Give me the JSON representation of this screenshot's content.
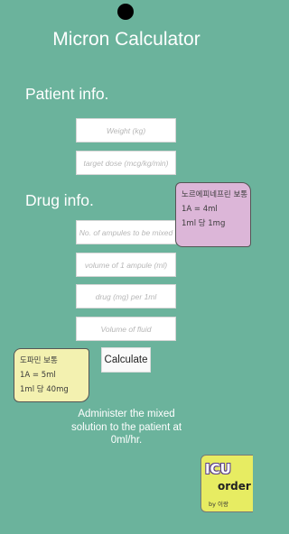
{
  "app": {
    "title": "Micron Calculator"
  },
  "patient": {
    "heading": "Patient info.",
    "weight_placeholder": "Weight (kg)",
    "dose_placeholder": "target dose (mcg/kg/min)"
  },
  "drug": {
    "heading": "Drug info.",
    "ampules_placeholder": "No. of ampules to be mixed",
    "ampule_volume_placeholder": "volume of 1 ampule (ml)",
    "drug_per_ml_placeholder": "drug (mg) per 1ml",
    "fluid_volume_placeholder": "Volume of fluid"
  },
  "actions": {
    "calculate_label": "Calculate"
  },
  "result": {
    "line1": "Administer the mixed",
    "line2": "solution to the patient at",
    "line3": "0ml/hr."
  },
  "notes": {
    "pink": {
      "line1": "노르에피네프린 보통",
      "line2": "1A = 4ml",
      "line3": "1ml 당 1mg"
    },
    "yellow": {
      "line1": "도파민 보통",
      "line2": "1A = 5ml",
      "line3": "1ml 당 40mg"
    }
  },
  "logo": {
    "big": "ICU",
    "order": "order",
    "by": "by 이랑"
  },
  "colors": {
    "background": "#6bb39c",
    "note_pink": "#dcb6d8",
    "note_yellow": "#f3f1b0",
    "logo_bg": "#e7ec62"
  }
}
